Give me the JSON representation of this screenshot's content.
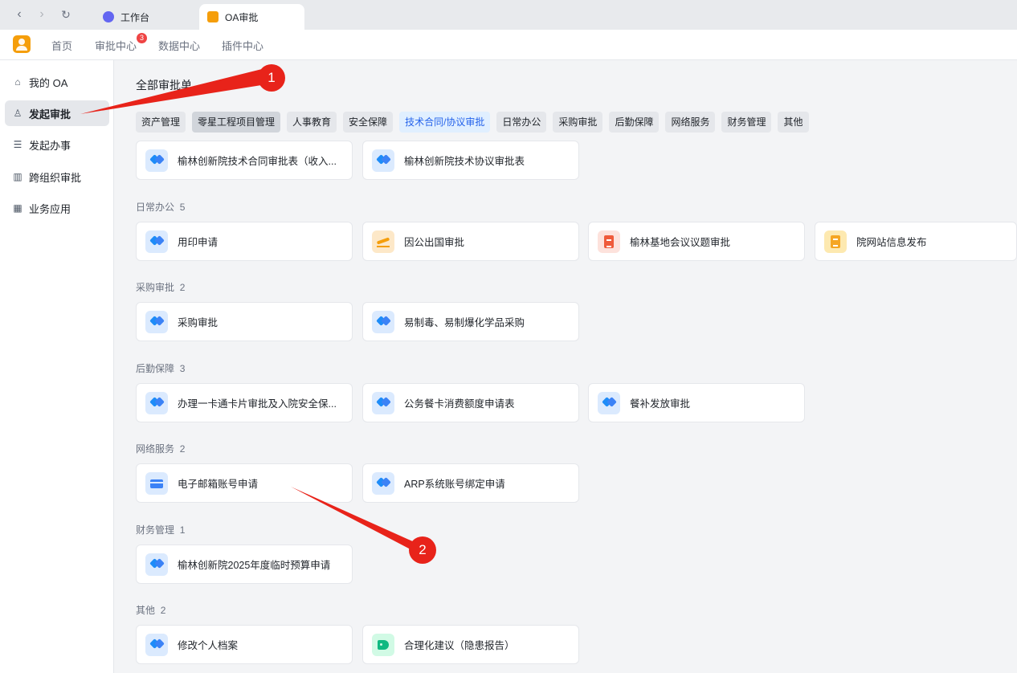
{
  "browser": {
    "tabs": [
      {
        "label": "工作台"
      },
      {
        "label": "OA审批"
      }
    ]
  },
  "appbar": {
    "nav": [
      {
        "label": "首页"
      },
      {
        "label": "审批中心",
        "badge": "3"
      },
      {
        "label": "数据中心"
      },
      {
        "label": "插件中心"
      }
    ]
  },
  "sidebar": {
    "items": [
      {
        "label": "我的 OA",
        "icon": "home-icon"
      },
      {
        "label": "发起审批",
        "icon": "stamp-icon",
        "active": true
      },
      {
        "label": "发起办事",
        "icon": "list-icon"
      },
      {
        "label": "跨组织审批",
        "icon": "building-icon"
      },
      {
        "label": "业务应用",
        "icon": "grid-icon"
      }
    ]
  },
  "main": {
    "title": "全部审批单",
    "chips": [
      "资产管理",
      "零星工程项目管理",
      "人事教育",
      "安全保障",
      "技术合同/协议审批",
      "日常办公",
      "采购审批",
      "后勤保障",
      "网络服务",
      "财务管理",
      "其他"
    ],
    "tech_cards": [
      "榆林创新院技术合同审批表（收入...",
      "榆林创新院技术协议审批表"
    ],
    "groups": [
      {
        "name": "日常办公",
        "count": "5",
        "cards": [
          "用印申请",
          "因公出国审批",
          "榆林基地会议议题审批",
          "院网站信息发布"
        ]
      },
      {
        "name": "采购审批",
        "count": "2",
        "cards": [
          "采购审批",
          "易制毒、易制爆化学品采购"
        ]
      },
      {
        "name": "后勤保障",
        "count": "3",
        "cards": [
          "办理一卡通卡片审批及入院安全保...",
          "公务餐卡消费额度申请表",
          "餐补发放审批"
        ]
      },
      {
        "name": "网络服务",
        "count": "2",
        "cards": [
          "电子邮箱账号申请",
          "ARP系统账号绑定申请"
        ]
      },
      {
        "name": "财务管理",
        "count": "1",
        "cards": [
          "榆林创新院2025年度临时预算申请"
        ]
      },
      {
        "name": "其他",
        "count": "2",
        "cards": [
          "修改个人档案",
          "合理化建议（隐患报告）"
        ]
      }
    ]
  },
  "annotations": {
    "marker_1": "1",
    "marker_2": "2",
    "color": "#e8231a"
  }
}
